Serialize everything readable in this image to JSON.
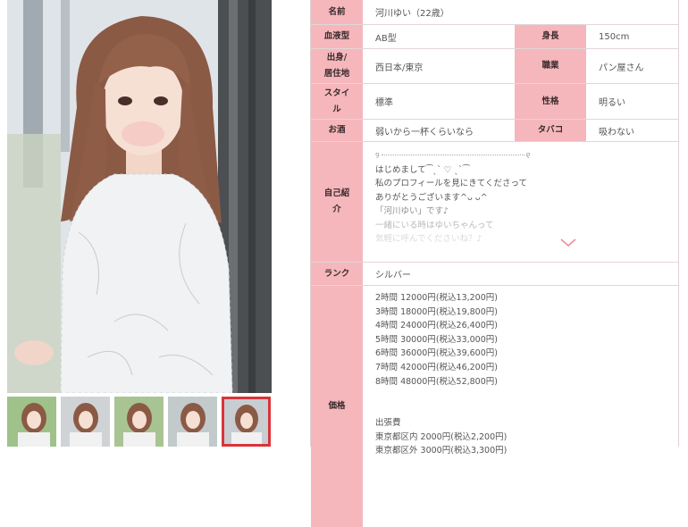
{
  "profile": {
    "name": {
      "label": "名前",
      "value": "河川ゆい（22歳）"
    },
    "blood": {
      "label": "血液型",
      "value": "AB型"
    },
    "height": {
      "label": "身長",
      "value": "150cm"
    },
    "origin": {
      "label": "出身/\n居住地",
      "label_line1": "出身/",
      "label_line2": "居住地",
      "value": "西日本/東京"
    },
    "job": {
      "label": "職業",
      "value": "パン屋さん"
    },
    "style": {
      "label_line1": "スタイ",
      "label_line2": "ル",
      "value": "標準"
    },
    "personality": {
      "label": "性格",
      "value": "明るい"
    },
    "alcohol": {
      "label": "お酒",
      "value": "弱いから一杯くらいなら"
    },
    "tobacco": {
      "label": "タバコ",
      "value": "吸わない"
    },
    "intro": {
      "label_line1": "自己紹",
      "label_line2": "介",
      "deco_left": "୨",
      "deco_right": "୧",
      "lines": [
        "はじめまして⁀ˎˋ ♡ ˎˋ⁀",
        "私のプロフィールを見にきてくださって",
        "ありがとうございます^ᴗ ᴗ^",
        "「河川ゆい」です♪",
        "一緒にいる時はゆいちゃんって",
        "気軽に呼んでくださいね？♪"
      ],
      "expand_icon": "chevron-down-icon"
    },
    "rank": {
      "label": "ランク",
      "value": "シルバー"
    },
    "price": {
      "label": "価格",
      "courses": [
        {
          "time": "2時間",
          "price": "12000円",
          "tax": "(税込13,200円)"
        },
        {
          "time": "3時間",
          "price": "18000円",
          "tax": "(税込19,800円)"
        },
        {
          "time": "4時間",
          "price": "24000円",
          "tax": "(税込26,400円)"
        },
        {
          "time": "5時間",
          "price": "30000円",
          "tax": "(税込33,000円)"
        },
        {
          "time": "6時間",
          "price": "36000円",
          "tax": "(税込39,600円)"
        },
        {
          "time": "7時間",
          "price": "42000円",
          "tax": "(税込46,200円)"
        },
        {
          "time": "8時間",
          "price": "48000円",
          "tax": "(税込52,800円)"
        }
      ],
      "travel_title": "出張費",
      "travel": [
        {
          "area": "東京都区内",
          "price": "2000円",
          "tax": "(税込2,200円)"
        },
        {
          "area": "東京都区外",
          "price": "3000円",
          "tax": "(税込3,300円)"
        }
      ]
    }
  },
  "colors": {
    "label_bg": "#f5b7bc",
    "active_thumb": "#d9343a",
    "chevron": "#f08a93"
  },
  "gallery": {
    "thumb_count": 5,
    "active_index": 4
  }
}
